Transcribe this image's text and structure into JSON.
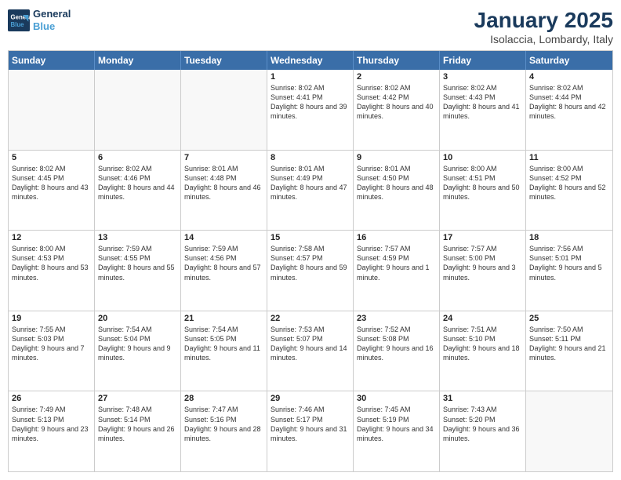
{
  "header": {
    "logo_line1": "General",
    "logo_line2": "Blue",
    "month": "January 2025",
    "location": "Isolaccia, Lombardy, Italy"
  },
  "weekdays": [
    "Sunday",
    "Monday",
    "Tuesday",
    "Wednesday",
    "Thursday",
    "Friday",
    "Saturday"
  ],
  "weeks": [
    [
      {
        "day": "",
        "content": ""
      },
      {
        "day": "",
        "content": ""
      },
      {
        "day": "",
        "content": ""
      },
      {
        "day": "1",
        "content": "Sunrise: 8:02 AM\nSunset: 4:41 PM\nDaylight: 8 hours and 39 minutes."
      },
      {
        "day": "2",
        "content": "Sunrise: 8:02 AM\nSunset: 4:42 PM\nDaylight: 8 hours and 40 minutes."
      },
      {
        "day": "3",
        "content": "Sunrise: 8:02 AM\nSunset: 4:43 PM\nDaylight: 8 hours and 41 minutes."
      },
      {
        "day": "4",
        "content": "Sunrise: 8:02 AM\nSunset: 4:44 PM\nDaylight: 8 hours and 42 minutes."
      }
    ],
    [
      {
        "day": "5",
        "content": "Sunrise: 8:02 AM\nSunset: 4:45 PM\nDaylight: 8 hours and 43 minutes."
      },
      {
        "day": "6",
        "content": "Sunrise: 8:02 AM\nSunset: 4:46 PM\nDaylight: 8 hours and 44 minutes."
      },
      {
        "day": "7",
        "content": "Sunrise: 8:01 AM\nSunset: 4:48 PM\nDaylight: 8 hours and 46 minutes."
      },
      {
        "day": "8",
        "content": "Sunrise: 8:01 AM\nSunset: 4:49 PM\nDaylight: 8 hours and 47 minutes."
      },
      {
        "day": "9",
        "content": "Sunrise: 8:01 AM\nSunset: 4:50 PM\nDaylight: 8 hours and 48 minutes."
      },
      {
        "day": "10",
        "content": "Sunrise: 8:00 AM\nSunset: 4:51 PM\nDaylight: 8 hours and 50 minutes."
      },
      {
        "day": "11",
        "content": "Sunrise: 8:00 AM\nSunset: 4:52 PM\nDaylight: 8 hours and 52 minutes."
      }
    ],
    [
      {
        "day": "12",
        "content": "Sunrise: 8:00 AM\nSunset: 4:53 PM\nDaylight: 8 hours and 53 minutes."
      },
      {
        "day": "13",
        "content": "Sunrise: 7:59 AM\nSunset: 4:55 PM\nDaylight: 8 hours and 55 minutes."
      },
      {
        "day": "14",
        "content": "Sunrise: 7:59 AM\nSunset: 4:56 PM\nDaylight: 8 hours and 57 minutes."
      },
      {
        "day": "15",
        "content": "Sunrise: 7:58 AM\nSunset: 4:57 PM\nDaylight: 8 hours and 59 minutes."
      },
      {
        "day": "16",
        "content": "Sunrise: 7:57 AM\nSunset: 4:59 PM\nDaylight: 9 hours and 1 minute."
      },
      {
        "day": "17",
        "content": "Sunrise: 7:57 AM\nSunset: 5:00 PM\nDaylight: 9 hours and 3 minutes."
      },
      {
        "day": "18",
        "content": "Sunrise: 7:56 AM\nSunset: 5:01 PM\nDaylight: 9 hours and 5 minutes."
      }
    ],
    [
      {
        "day": "19",
        "content": "Sunrise: 7:55 AM\nSunset: 5:03 PM\nDaylight: 9 hours and 7 minutes."
      },
      {
        "day": "20",
        "content": "Sunrise: 7:54 AM\nSunset: 5:04 PM\nDaylight: 9 hours and 9 minutes."
      },
      {
        "day": "21",
        "content": "Sunrise: 7:54 AM\nSunset: 5:05 PM\nDaylight: 9 hours and 11 minutes."
      },
      {
        "day": "22",
        "content": "Sunrise: 7:53 AM\nSunset: 5:07 PM\nDaylight: 9 hours and 14 minutes."
      },
      {
        "day": "23",
        "content": "Sunrise: 7:52 AM\nSunset: 5:08 PM\nDaylight: 9 hours and 16 minutes."
      },
      {
        "day": "24",
        "content": "Sunrise: 7:51 AM\nSunset: 5:10 PM\nDaylight: 9 hours and 18 minutes."
      },
      {
        "day": "25",
        "content": "Sunrise: 7:50 AM\nSunset: 5:11 PM\nDaylight: 9 hours and 21 minutes."
      }
    ],
    [
      {
        "day": "26",
        "content": "Sunrise: 7:49 AM\nSunset: 5:13 PM\nDaylight: 9 hours and 23 minutes."
      },
      {
        "day": "27",
        "content": "Sunrise: 7:48 AM\nSunset: 5:14 PM\nDaylight: 9 hours and 26 minutes."
      },
      {
        "day": "28",
        "content": "Sunrise: 7:47 AM\nSunset: 5:16 PM\nDaylight: 9 hours and 28 minutes."
      },
      {
        "day": "29",
        "content": "Sunrise: 7:46 AM\nSunset: 5:17 PM\nDaylight: 9 hours and 31 minutes."
      },
      {
        "day": "30",
        "content": "Sunrise: 7:45 AM\nSunset: 5:19 PM\nDaylight: 9 hours and 34 minutes."
      },
      {
        "day": "31",
        "content": "Sunrise: 7:43 AM\nSunset: 5:20 PM\nDaylight: 9 hours and 36 minutes."
      },
      {
        "day": "",
        "content": ""
      }
    ]
  ]
}
